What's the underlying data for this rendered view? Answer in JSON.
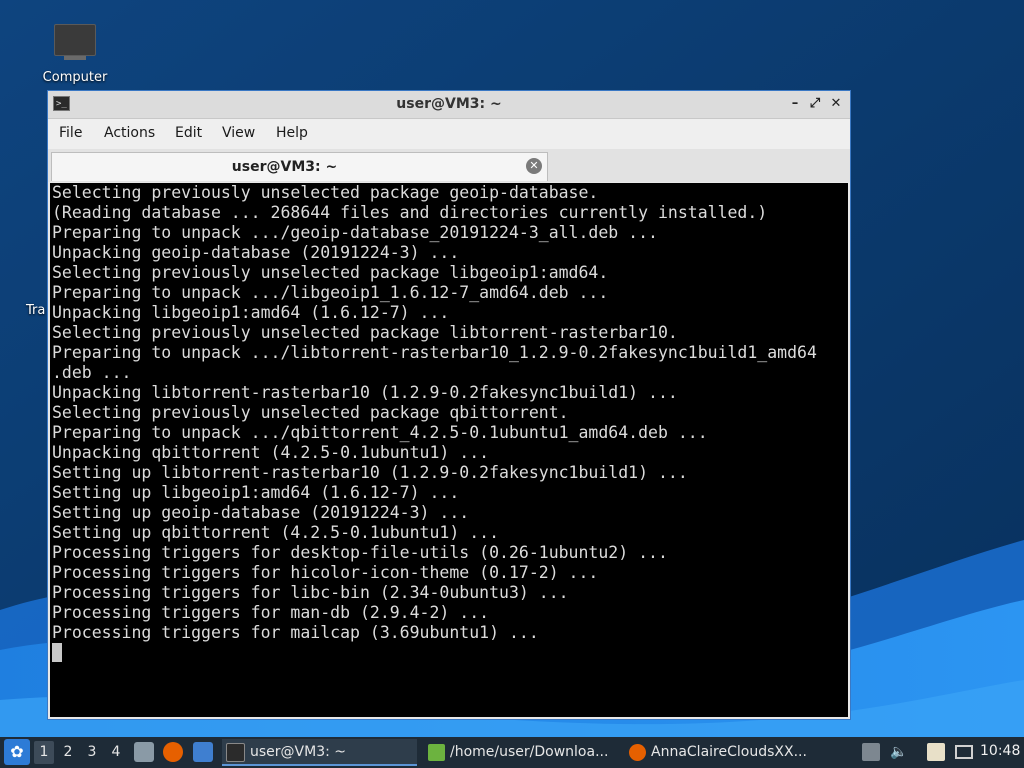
{
  "desktop": {
    "icons": [
      {
        "label": "Computer"
      },
      {
        "label": "Tra"
      }
    ]
  },
  "window": {
    "title": "user@VM3: ~",
    "controls": {
      "minimize": "–",
      "maximize": "⤢",
      "close": "✕"
    },
    "menu": [
      "File",
      "Actions",
      "Edit",
      "View",
      "Help"
    ],
    "tab": {
      "label": "user@VM3: ~",
      "close": "✕"
    },
    "terminal_lines": [
      "Selecting previously unselected package geoip-database.",
      "(Reading database ... 268644 files and directories currently installed.)",
      "Preparing to unpack .../geoip-database_20191224-3_all.deb ...",
      "Unpacking geoip-database (20191224-3) ...",
      "Selecting previously unselected package libgeoip1:amd64.",
      "Preparing to unpack .../libgeoip1_1.6.12-7_amd64.deb ...",
      "Unpacking libgeoip1:amd64 (1.6.12-7) ...",
      "Selecting previously unselected package libtorrent-rasterbar10.",
      "Preparing to unpack .../libtorrent-rasterbar10_1.2.9-0.2fakesync1build1_amd64",
      ".deb ...",
      "Unpacking libtorrent-rasterbar10 (1.2.9-0.2fakesync1build1) ...",
      "Selecting previously unselected package qbittorrent.",
      "Preparing to unpack .../qbittorrent_4.2.5-0.1ubuntu1_amd64.deb ...",
      "Unpacking qbittorrent (4.2.5-0.1ubuntu1) ...",
      "Setting up libtorrent-rasterbar10 (1.2.9-0.2fakesync1build1) ...",
      "Setting up libgeoip1:amd64 (1.6.12-7) ...",
      "Setting up geoip-database (20191224-3) ...",
      "Setting up qbittorrent (4.2.5-0.1ubuntu1) ...",
      "Processing triggers for desktop-file-utils (0.26-1ubuntu2) ...",
      "Processing triggers for hicolor-icon-theme (0.17-2) ...",
      "Processing triggers for libc-bin (2.34-0ubuntu3) ...",
      "Processing triggers for man-db (2.9.4-2) ...",
      "Processing triggers for mailcap (3.69ubuntu1) ..."
    ]
  },
  "taskbar": {
    "workspaces": [
      "1",
      "2",
      "3",
      "4"
    ],
    "tasks": [
      {
        "label": "user@VM3: ~"
      },
      {
        "label": "/home/user/Downloa..."
      },
      {
        "label": "AnnaClaireCloudsXX..."
      }
    ],
    "clock": "10:48"
  },
  "colors": {
    "desktop_bg": "#0a3a6e",
    "wave_light": "#2a8ae8",
    "window_border": "#3a78c4",
    "terminal_bg": "#000000",
    "terminal_fg": "#dcdcdc",
    "taskbar_bg": "#1e2b37"
  },
  "icons": {
    "window": "terminal-icon",
    "start": "lubuntu-logo-icon",
    "files": "file-manager-icon",
    "browser": "firefox-icon",
    "show_desktop": "desktop-icon",
    "tray": [
      "drive-icon",
      "volume-icon",
      "clipboard-icon",
      "network-icon"
    ]
  }
}
